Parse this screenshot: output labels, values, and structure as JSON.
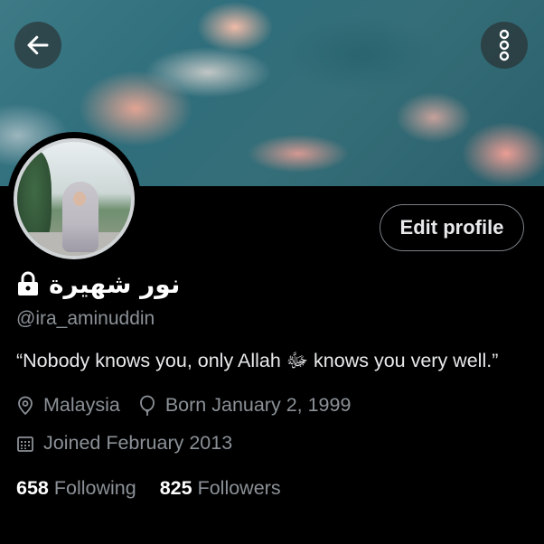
{
  "header": {
    "icons": {
      "back": "arrow-left-icon",
      "more": "more-vertical-icon"
    }
  },
  "profile": {
    "edit_label": "Edit profile",
    "display_name": "نور شهيرة",
    "handle": "@ira_aminuddin",
    "bio": "“Nobody knows you, only Allah ﷻ knows you very well.”",
    "location": "Malaysia",
    "birthday": "Born January 2, 1999",
    "joined": "Joined February 2013",
    "following_count": "658",
    "following_label": "Following",
    "followers_count": "825",
    "followers_label": "Followers"
  },
  "colors": {
    "background": "#000000",
    "text": "#e7e9ea",
    "muted": "#8b9197",
    "border": "#7a7f84"
  }
}
